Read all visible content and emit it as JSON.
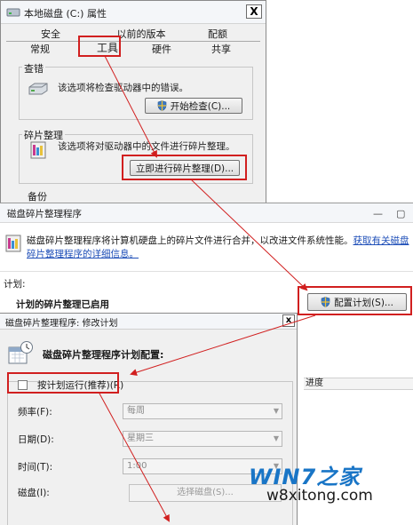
{
  "properties_window": {
    "title": "本地磁盘 (C:) 属性",
    "close_glyph": "X",
    "tabs_top": [
      "安全",
      "以前的版本",
      "配额"
    ],
    "tabs_bottom": [
      "常规",
      "工具",
      "硬件",
      "共享"
    ],
    "error_check": {
      "group_title": "查错",
      "description": "该选项将检查驱动器中的错误。",
      "button_label": "开始检查(C)..."
    },
    "defrag": {
      "group_title": "碎片整理",
      "description": "该选项将对驱动器中的文件进行碎片整理。",
      "button_label": "立即进行碎片整理(D)..."
    },
    "backup": {
      "group_title": "备份"
    }
  },
  "defrag_window": {
    "title": "磁盘碎片整理程序",
    "intro_text": "磁盘碎片整理程序将计算机硬盘上的碎片文件进行合并，以改进文件系统性能。",
    "intro_link": "获取有关磁盘碎片整理程序的详细信息。",
    "schedule_label": "计划:",
    "schedule_status": "计划的碎片整理已启用",
    "configure_button": "配置计划(S)...",
    "progress_header": "进度",
    "minimize_glyph": "—",
    "maximize_glyph": "▢"
  },
  "modify_window": {
    "title": "磁盘碎片整理程序: 修改计划",
    "close_glyph": "x",
    "heading": "磁盘碎片整理程序计划配置:",
    "run_on_schedule_label": "按计划运行(推荐)(R)",
    "run_on_schedule_checked": false,
    "frequency": {
      "label": "频率(F):",
      "value": "每周"
    },
    "day": {
      "label": "日期(D):",
      "value": "星期三"
    },
    "time": {
      "label": "时间(T):",
      "value": "1:00"
    },
    "disks": {
      "label": "磁盘(I):",
      "button_label": "选择磁盘(S)..."
    },
    "combo_arrow": "▼"
  },
  "watermark": {
    "logo_text": "WIN7之家",
    "site": "w8xitong.com"
  },
  "colors": {
    "annotation_red": "#d11f1f",
    "watermark_blue": "#1975c6",
    "link_blue": "#1f4fb8"
  }
}
